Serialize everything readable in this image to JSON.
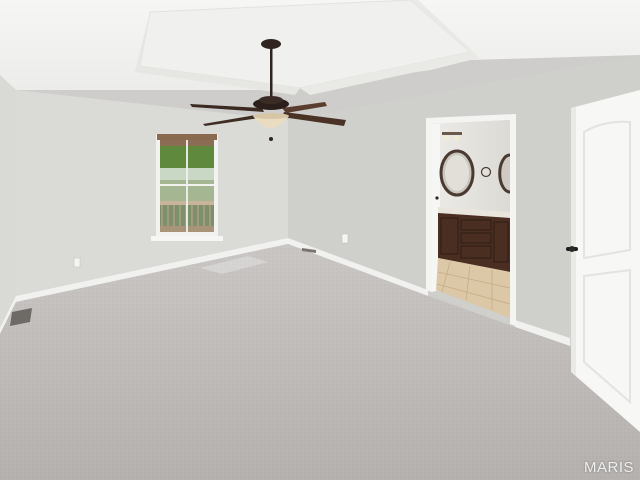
{
  "photo": {
    "watermark": "MARIS"
  },
  "colors": {
    "ceiling": "#f3f3f1",
    "wall_left": "#dcdcd9",
    "wall_back": "#d3d3d0",
    "wall_right": "#cdcdca",
    "carpet": "#bdb9b7",
    "trim": "#f4f4f2",
    "door": "#f7f7f5",
    "fan_dark": "#2f2420",
    "cabinet": "#4a2e22",
    "tile": "#dcc7a6"
  },
  "icons": {
    "fan": "ceiling-fan",
    "door_knob": "door-handle",
    "vent": "floor-vent"
  }
}
